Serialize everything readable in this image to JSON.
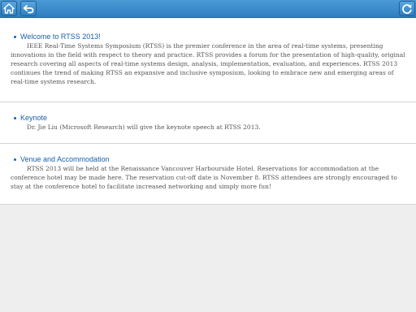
{
  "toolbar": {
    "home_icon": "home-icon",
    "back_icon": "back-arrow-icon",
    "refresh_icon": "refresh-icon",
    "color": "#2f7fc1"
  },
  "sections": [
    {
      "title": "Welcome to RTSS 2013!",
      "body": "IEEE Real-Time Systems Symposium (RTSS) is the premier conference in the area of real-time systems, presenting innovations in the field with respect to theory and practice. RTSS provides a forum for the presentation of high-quality, original research covering all aspects of real-time systems design, analysis, implementation, evaluation, and experiences. RTSS 2013 continues the trend of making RTSS an expansive and inclusive symposium, looking to embrace new and emerging areas of real-time systems research."
    },
    {
      "title": "Keynote",
      "body": "Dr. Jie Liu (Microsoft Research) will give the keynote speech at RTSS 2013."
    },
    {
      "title": "Venue and Accommodation",
      "body": "RTSS 2013 will be held at the Renaissance Vancouver Harbourside Hotel. Reservations for accommodation at the conference hotel may be made here. The reservation cut-off date is November 8. RTSS attendees are strongly encouraged to stay at the conference hotel to facilitate increased networking and simply more fun!"
    }
  ]
}
